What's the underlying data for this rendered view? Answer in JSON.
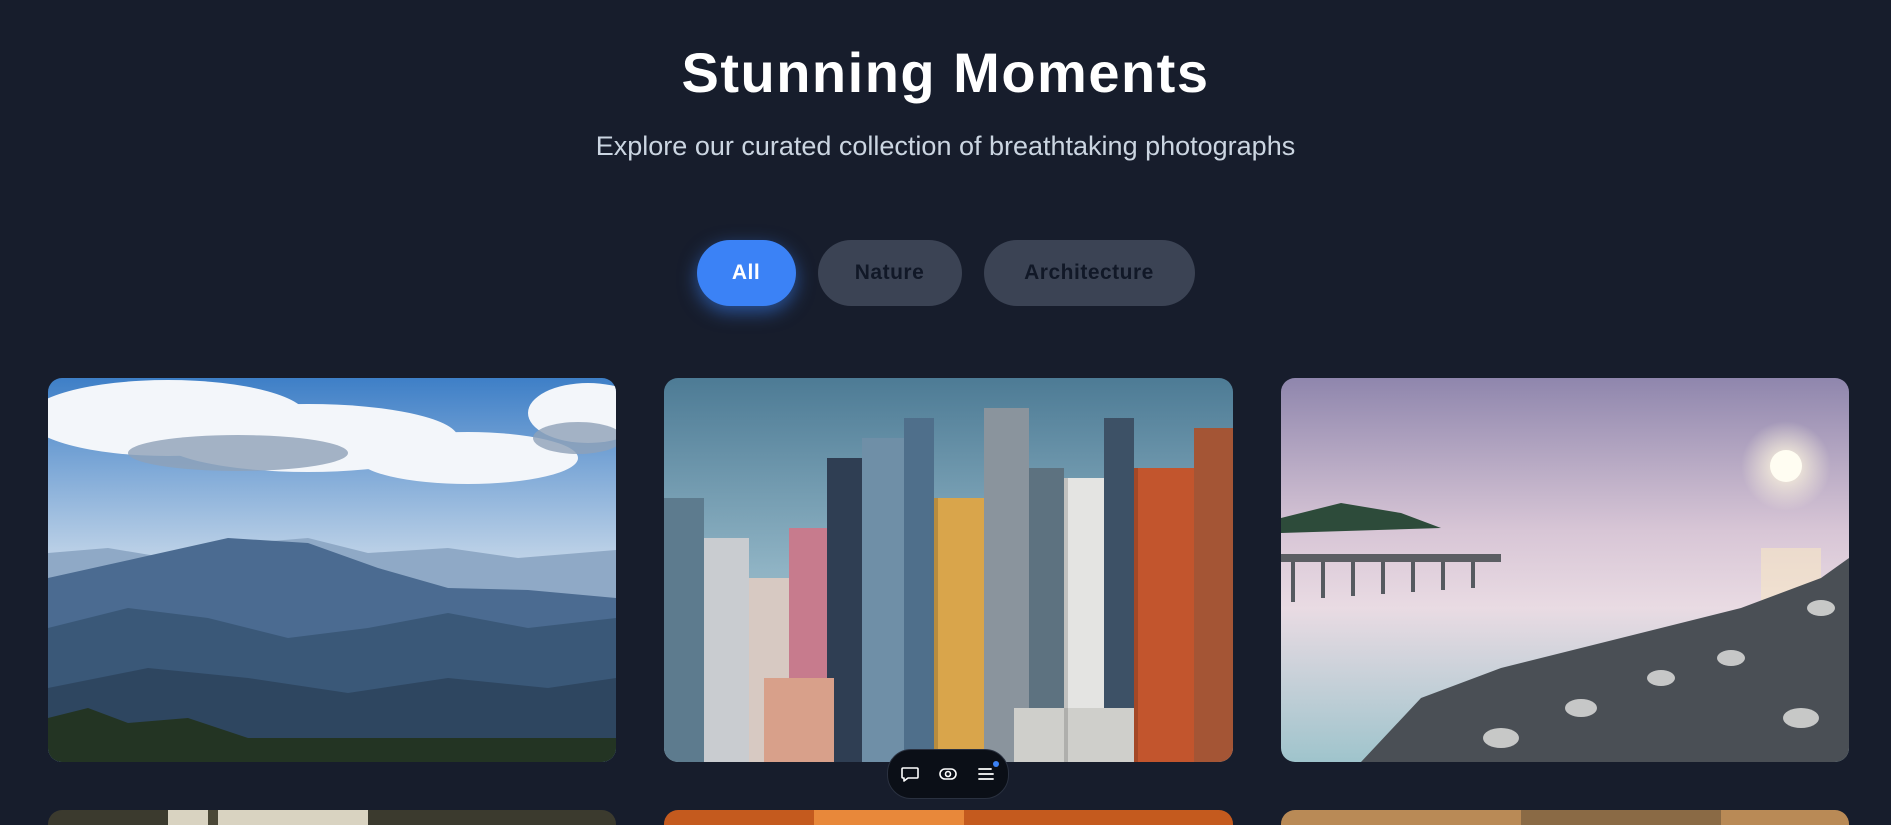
{
  "header": {
    "title": "Stunning Moments",
    "subtitle": "Explore our curated collection of breathtaking photographs"
  },
  "filters": [
    {
      "label": "All",
      "active": true
    },
    {
      "label": "Nature",
      "active": false
    },
    {
      "label": "Architecture",
      "active": false
    }
  ],
  "colors": {
    "background": "#171d2c",
    "accent": "#3b82f6",
    "inactive_pill": "#3b4354"
  },
  "gallery": {
    "images": [
      {
        "subject": "mountain-landscape"
      },
      {
        "subject": "city-skyscrapers"
      },
      {
        "subject": "pier-sunset-seascape"
      },
      {
        "subject": "forest-partial"
      },
      {
        "subject": "sunset-city-partial"
      },
      {
        "subject": "desert-partial"
      }
    ]
  },
  "toolbar": {
    "icons": [
      "comment-icon",
      "eye-icon",
      "menu-icon"
    ]
  }
}
